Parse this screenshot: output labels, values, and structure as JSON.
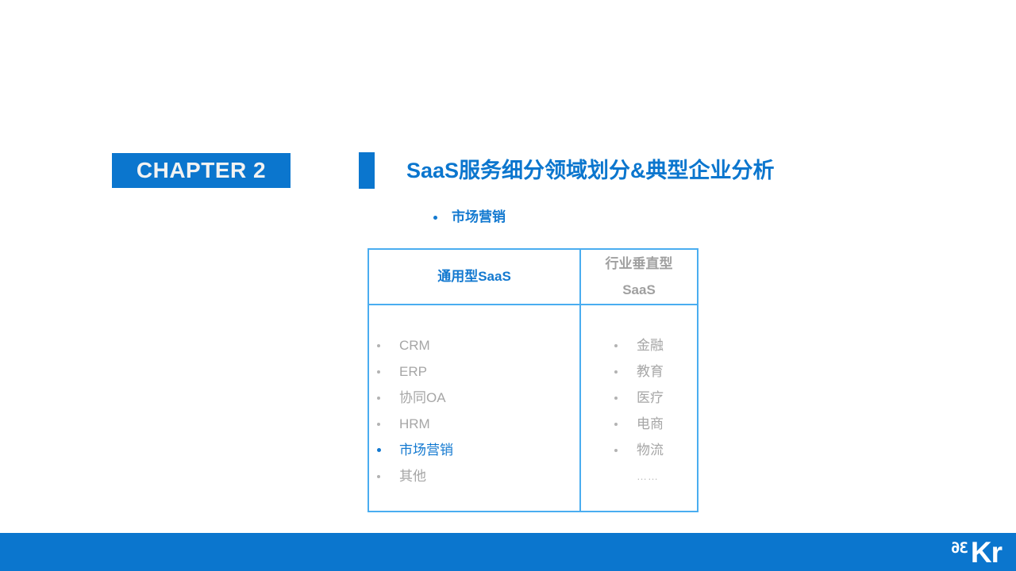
{
  "header": {
    "chapter_badge": "CHAPTER 2",
    "title": "SaaS服务细分领域划分&典型企业分析",
    "subtitle": "市场营销"
  },
  "colors": {
    "brand_blue": "#0b76ce",
    "accent_blue": "#1379d0",
    "table_border": "#4aadf0",
    "muted_gray": "#a6a6a6"
  },
  "table": {
    "columns": [
      {
        "header": "通用型SaaS",
        "header_lines": [
          "通用型SaaS"
        ],
        "items": [
          {
            "label": "CRM",
            "highlighted": false
          },
          {
            "label": "ERP",
            "highlighted": false
          },
          {
            "label": "协同OA",
            "highlighted": false
          },
          {
            "label": "HRM",
            "highlighted": false
          },
          {
            "label": "市场营销",
            "highlighted": true
          },
          {
            "label": "其他",
            "highlighted": false
          }
        ],
        "trailing": ""
      },
      {
        "header": "行业垂直型 SaaS",
        "header_lines": [
          "行业垂直型",
          "SaaS"
        ],
        "items": [
          {
            "label": "金融",
            "highlighted": false
          },
          {
            "label": "教育",
            "highlighted": false
          },
          {
            "label": "医疗",
            "highlighted": false
          },
          {
            "label": "电商",
            "highlighted": false
          },
          {
            "label": "物流",
            "highlighted": false
          }
        ],
        "trailing": "……"
      }
    ]
  },
  "footer": {
    "logo_36": "36",
    "logo_kr": "Kr"
  }
}
